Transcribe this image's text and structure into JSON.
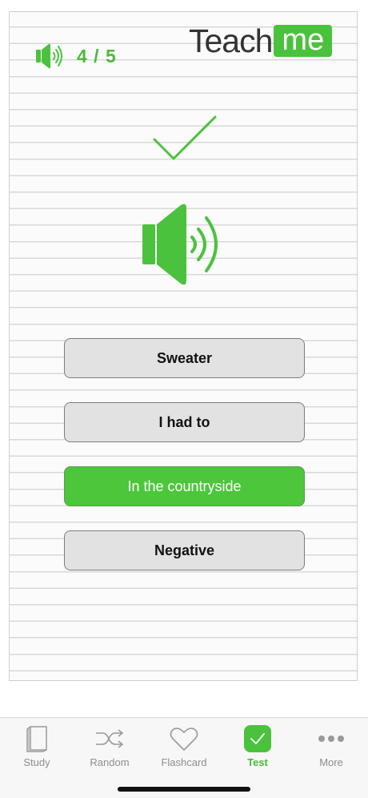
{
  "header": {
    "progress": "4 / 5",
    "logo_left": "Teach",
    "logo_right": "me"
  },
  "answers": [
    {
      "label": "Sweater",
      "state": "default"
    },
    {
      "label": "I had to",
      "state": "default"
    },
    {
      "label": "In the countryside",
      "state": "correct"
    },
    {
      "label": "Negative",
      "state": "default"
    }
  ],
  "tabs": [
    {
      "label": "Study",
      "icon": "book-icon"
    },
    {
      "label": "Random",
      "icon": "shuffle-icon"
    },
    {
      "label": "Flashcard",
      "icon": "heart-icon"
    },
    {
      "label": "Test",
      "icon": "checkmark-icon",
      "active": true
    },
    {
      "label": "More",
      "icon": "more-dots-icon"
    }
  ],
  "colors": {
    "accent": "#4bc23d",
    "button_default": "#e2e2e2",
    "tab_inactive": "#8e8e93"
  }
}
